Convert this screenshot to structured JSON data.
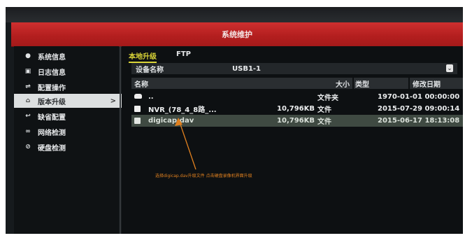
{
  "window": {
    "title": "系统维护"
  },
  "sidebar": {
    "items": [
      {
        "label": "系统信息",
        "icon": "info-dot-icon"
      },
      {
        "label": "日志信息",
        "icon": "log-icon"
      },
      {
        "label": "配置操作",
        "icon": "config-icon"
      },
      {
        "label": "版本升级",
        "icon": "home-icon",
        "active": true,
        "chevron": ">"
      },
      {
        "label": "缺省配置",
        "icon": "reset-icon"
      },
      {
        "label": "网络检测",
        "icon": "network-icon"
      },
      {
        "label": "硬盘检测",
        "icon": "disk-icon"
      }
    ]
  },
  "tabs": [
    {
      "label": "本地升级",
      "active": true
    },
    {
      "label": "FTP",
      "active": false
    }
  ],
  "device": {
    "label": "设备名称",
    "value": "USB1-1",
    "chevron": "⌄"
  },
  "table": {
    "headers": {
      "name": "名称",
      "size": "大小",
      "type": "类型",
      "date": "修改日期"
    },
    "rows": [
      {
        "name": "..",
        "size": "",
        "type": "文件夹",
        "date": "1970-01-01 00:00:00",
        "icon": "folder-icon"
      },
      {
        "name": "NVR_(78_4_8路_...",
        "size": "10,796KB",
        "type": "文件",
        "date": "2015-07-29 09:00:14",
        "icon": "file-icon"
      },
      {
        "name": "digicap.dav",
        "size": "10,796KB",
        "type": "文件",
        "date": "2015-06-17 18:13:08",
        "icon": "file-icon",
        "selected": true
      }
    ]
  },
  "annotation": {
    "text": "选择digicap.dav升级文件 点击硬盘录像机界面升级"
  },
  "colors": {
    "title_bar": "#b21e1e",
    "active_tab": "#d9d437",
    "annotation": "#e0801f"
  }
}
